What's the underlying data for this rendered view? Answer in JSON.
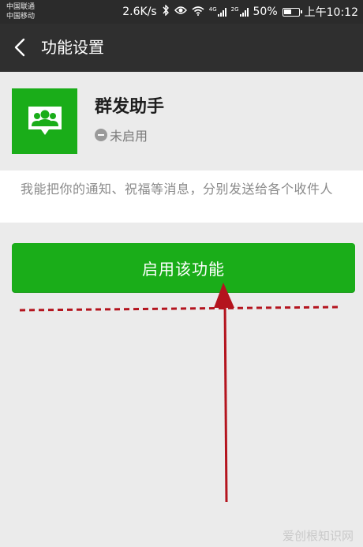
{
  "status_bar": {
    "carrier1": "中国联通",
    "carrier2": "中国移动",
    "net_speed": "2.6K/s",
    "net1": "4G",
    "net2": "2G",
    "battery": "50%",
    "battery_level": 0.5,
    "time": "上午10:12"
  },
  "header": {
    "title": "功能设置",
    "back_icon": "chevron-left-icon"
  },
  "app": {
    "name": "群发助手",
    "status": "未启用",
    "icon": "group-chat-icon",
    "icon_color": "#1aad19"
  },
  "description": {
    "text": "我能把你的通知、祝福等消息，分别发送给各个收件人"
  },
  "enable_button": {
    "label": "启用该功能",
    "color": "#1aad19"
  },
  "annotation": {
    "color": "#b4141e"
  },
  "watermark": {
    "text": "爱创根知识网"
  }
}
